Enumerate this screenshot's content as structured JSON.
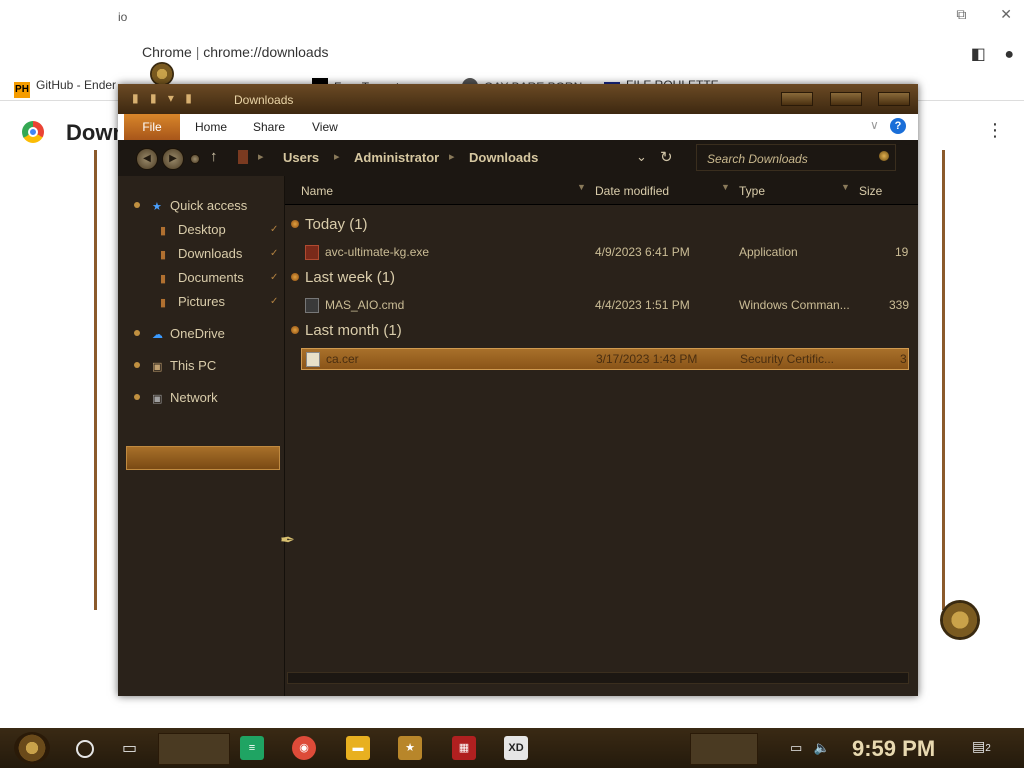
{
  "browser": {
    "tab_text": "io",
    "window_controls": [
      "⧉",
      "✕"
    ],
    "url_prefix": "Chrome",
    "url_path": "chrome://downloads",
    "bookmarks": [
      {
        "badge": "PH",
        "badge_color": "#f59c00",
        "label": "GitHub - Ender"
      },
      {
        "badge": "",
        "badge_color": "#000000",
        "label": "Free Torrent..."
      },
      {
        "badge": "",
        "badge_color": "#555555",
        "label": "GAY BARE PORN"
      },
      {
        "badge": "MF",
        "badge_color": "#1a2a8a",
        "label": "FILE ROULETTE"
      }
    ],
    "page_title": "Downloads",
    "page_menu": "⋮"
  },
  "explorer": {
    "title": "Downloads",
    "title_icons": "▮ ▮ ▾ ▮",
    "ribbon": {
      "file": "File",
      "tabs": [
        "Home",
        "Share",
        "View"
      ],
      "chevron": "∨",
      "help": "?"
    },
    "nav": {
      "back": "◀",
      "forward": "▶",
      "up": "↑",
      "breadcrumb": [
        "Users",
        "Administrator",
        "Downloads"
      ],
      "crumb_sep": "▸",
      "dropdown": "⌄",
      "refresh": "↻",
      "search_placeholder": "Search Downloads"
    },
    "sidebar": {
      "quick_access": "Quick access",
      "items": [
        {
          "label": "Desktop",
          "icon": "desktop-icon"
        },
        {
          "label": "Downloads",
          "icon": "downloads-icon"
        },
        {
          "label": "Documents",
          "icon": "documents-icon"
        },
        {
          "label": "Pictures",
          "icon": "pictures-icon"
        }
      ],
      "pin_glyph": "✓",
      "onedrive": "OneDrive",
      "this_pc": "This PC",
      "network": "Network"
    },
    "columns": {
      "name": "Name",
      "date": "Date modified",
      "type": "Type",
      "size": "Size"
    },
    "groups": [
      {
        "heading": "Today (1)",
        "files": [
          {
            "name": "avc-ultimate-kg.exe",
            "date": "4/9/2023 6:41 PM",
            "type": "Application",
            "size": "19",
            "selected": false
          }
        ]
      },
      {
        "heading": "Last week (1)",
        "files": [
          {
            "name": "MAS_AIO.cmd",
            "date": "4/4/2023 1:51 PM",
            "type": "Windows Comman...",
            "size": "339",
            "selected": false
          }
        ]
      },
      {
        "heading": "Last month (1)",
        "files": [
          {
            "name": "ca.cer",
            "date": "3/17/2023 1:43 PM",
            "type": "Security Certific...",
            "size": "3",
            "selected": true
          }
        ]
      }
    ]
  },
  "taskbar": {
    "clock": "9:59 PM",
    "notif_count": "2",
    "apps": [
      {
        "icon": "sheets-icon",
        "color": "#1fa463",
        "glyph": "≡"
      },
      {
        "icon": "chrome-icon",
        "color": "#dd4b39",
        "glyph": "◉"
      },
      {
        "icon": "folder-icon",
        "color": "#e8b020",
        "glyph": "▬"
      },
      {
        "icon": "game-icon",
        "color": "#b8862a",
        "glyph": "★"
      },
      {
        "icon": "media-icon",
        "color": "#b02020",
        "glyph": "▦"
      },
      {
        "icon": "xd-icon",
        "color": "#e6e6e6",
        "glyph": "XD"
      }
    ]
  },
  "colors": {
    "accent": "#a8702a",
    "window_bg": "#2a221a",
    "chrome_bg": "#ffffff"
  }
}
